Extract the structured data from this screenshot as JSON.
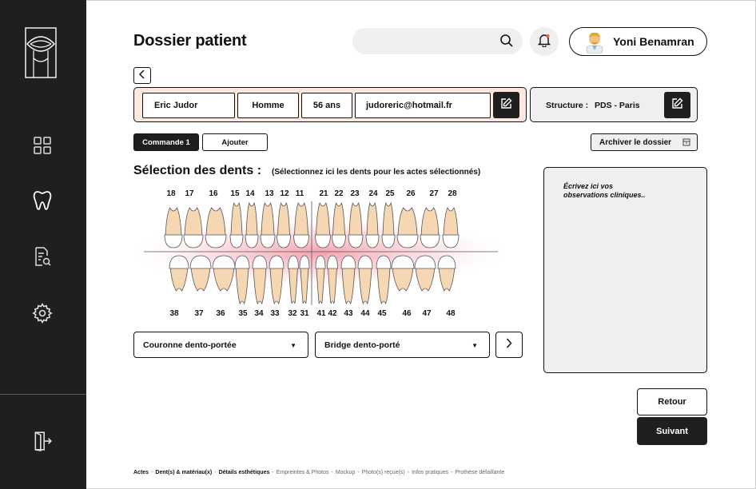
{
  "colors": {
    "sidebar": "#1f1f1f",
    "patient_bg": "#fde8df",
    "panel_bg": "#efefef",
    "accent_dark": "#1f1f1f"
  },
  "sidebar": {
    "items": [
      {
        "icon": "grid-icon"
      },
      {
        "icon": "tooth-icon"
      },
      {
        "icon": "document-search-icon"
      },
      {
        "icon": "gear-icon"
      },
      {
        "icon": "logout-icon"
      }
    ]
  },
  "header": {
    "title": "Dossier patient",
    "search_placeholder": "",
    "user_name": "Yoni Benamran"
  },
  "patient": {
    "name": "Eric Judor",
    "sex": "Homme",
    "age": "56 ans",
    "email": "judoreric@hotmail.fr"
  },
  "structure": {
    "label": "Structure :",
    "value": "PDS - Paris"
  },
  "tabs": [
    {
      "label": "Commande 1",
      "active": true
    },
    {
      "label": "Ajouter",
      "active": false
    }
  ],
  "archive_label": "Archiver le dossier",
  "selection": {
    "title": "Sélection des dents :",
    "subtitle": "(Sélectionnez ici les dents pour les actes sélectionnés)",
    "upper_teeth": [
      "18",
      "17",
      "16",
      "15",
      "14",
      "13",
      "12",
      "11",
      "21",
      "22",
      "23",
      "24",
      "25",
      "26",
      "27",
      "28"
    ],
    "lower_teeth": [
      "38",
      "37",
      "36",
      "35",
      "34",
      "33",
      "32",
      "31",
      "41",
      "42",
      "43",
      "44",
      "45",
      "46",
      "47",
      "48"
    ]
  },
  "selects": [
    {
      "value": "Couronne dento-portée"
    },
    {
      "value": "Bridge dento-porté"
    }
  ],
  "notes_placeholder": "Écrivez ici vos observations cliniques..",
  "buttons": {
    "back": "Retour",
    "next": "Suivant"
  },
  "steps": [
    {
      "label": "Actes",
      "done": true
    },
    {
      "label": "Dent(s) & matériau(x)",
      "done": true
    },
    {
      "label": "Détails esthétiques",
      "done": true
    },
    {
      "label": "Empreintes & Photos",
      "done": false
    },
    {
      "label": "Mockup",
      "done": false
    },
    {
      "label": "Photo(s) reçue(s)",
      "done": false
    },
    {
      "label": "Infos pratiques",
      "done": false
    },
    {
      "label": "Prothèse défaillante",
      "done": false
    }
  ]
}
